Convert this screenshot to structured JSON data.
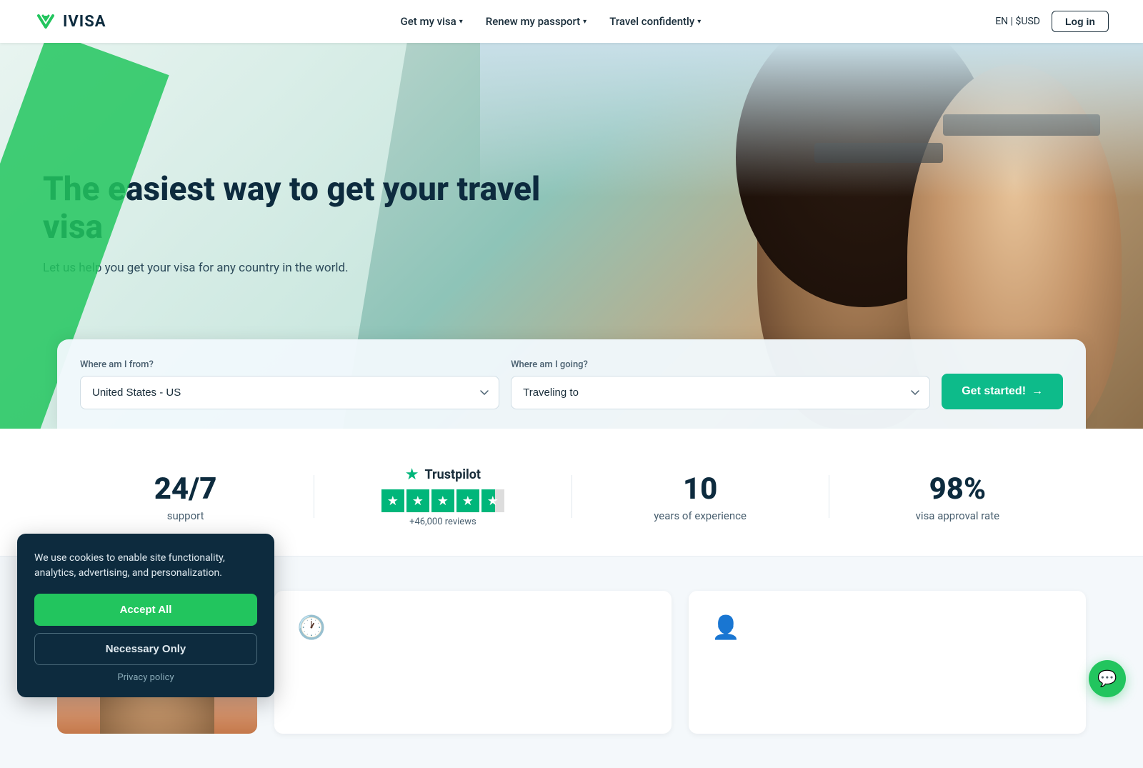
{
  "nav": {
    "logo_text": "IVISA",
    "links": [
      {
        "label": "Get my visa",
        "has_dropdown": true
      },
      {
        "label": "Renew my passport",
        "has_dropdown": true
      },
      {
        "label": "Travel confidently",
        "has_dropdown": true
      }
    ],
    "locale": "EN  |  $USD",
    "login_label": "Log in"
  },
  "hero": {
    "title": "The easiest way to get your travel visa",
    "subtitle": "Let us help you get your visa for any country in the world.",
    "from_label": "Where am I from?",
    "from_value": "United States - US",
    "from_placeholder": "United States - US",
    "to_label": "Where am I going?",
    "to_placeholder": "Traveling to",
    "cta_label": "Get started!",
    "cta_arrow": "→"
  },
  "stats": [
    {
      "number": "24/7",
      "label": "support"
    },
    {
      "type": "trustpilot",
      "tp_name": "Trustpilot",
      "tp_reviews": "+46,000 reviews"
    },
    {
      "number": "10",
      "label": "years of experience"
    },
    {
      "number": "98%",
      "label": "visa approval rate"
    }
  ],
  "cards": [
    {
      "icon": "🕐",
      "title": ""
    },
    {
      "icon": "👤",
      "title": ""
    }
  ],
  "cookie": {
    "text": "We use cookies to enable site functionality, analytics, advertising, and personalization.",
    "accept_label": "Accept All",
    "necessary_label": "Necessary Only",
    "privacy_label": "Privacy policy"
  },
  "chat": {
    "icon": "💬"
  }
}
